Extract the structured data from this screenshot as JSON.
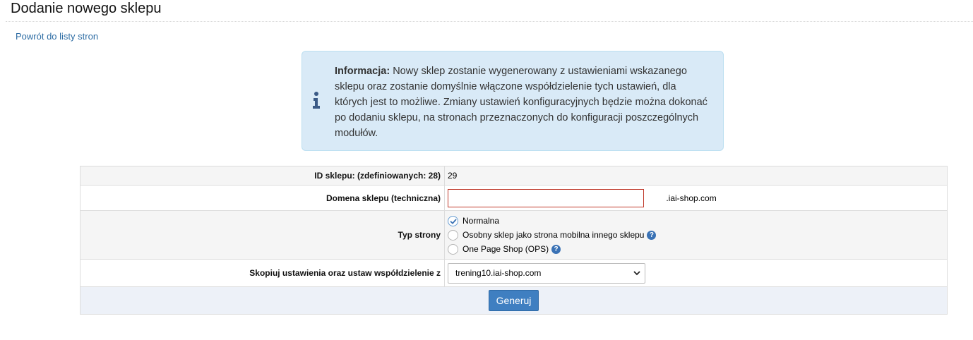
{
  "page": {
    "title": "Dodanie nowego sklepu",
    "back_link": "Powrót do listy stron"
  },
  "info": {
    "icon": "info-icon",
    "heading": "Informacja:",
    "text": " Nowy sklep zostanie wygenerowany z ustawieniami wskazanego sklepu oraz zostanie domyślnie włączone współdzielenie tych ustawień, dla których jest to możliwe. Zmiany ustawień konfiguracyjnych będzie można dokonać po dodaniu sklepu, na stronach przeznaczonych do konfiguracji poszczególnych modułów."
  },
  "form": {
    "shop_id": {
      "label": "ID sklepu: (zdefiniowanych: 28)",
      "value": "29"
    },
    "domain": {
      "label": "Domena sklepu (techniczna)",
      "value": "",
      "suffix": ".iai-shop.com"
    },
    "page_type": {
      "label": "Typ strony",
      "options": [
        {
          "label": "Normalna",
          "checked": true,
          "help": false
        },
        {
          "label": "Osobny sklep jako strona mobilna innego sklepu",
          "checked": false,
          "help": true
        },
        {
          "label": "One Page Shop (OPS)",
          "checked": false,
          "help": true
        }
      ]
    },
    "copy_from": {
      "label": "Skopiuj ustawienia oraz ustaw współdzielenie z",
      "selected": "trening10.iai-shop.com"
    },
    "generate_label": "Generuj"
  },
  "colors": {
    "link": "#2e6da4",
    "info_bg": "#d9eaf7",
    "button_bg": "#3f7fc1",
    "input_error_border": "#c0392b",
    "help_icon": "#3a72b5"
  }
}
